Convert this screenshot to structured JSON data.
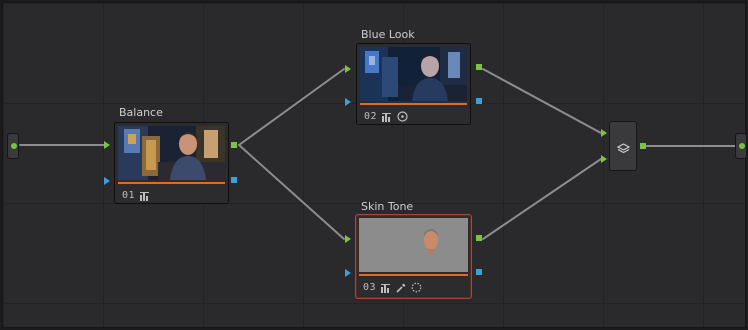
{
  "nodes": [
    {
      "id": "balance",
      "label": "Balance",
      "number": "01",
      "tools": [
        "histogram-icon"
      ]
    },
    {
      "id": "blue-look",
      "label": "Blue Look",
      "number": "02",
      "tools": [
        "histogram-icon",
        "circle-target-icon"
      ]
    },
    {
      "id": "skin-tone",
      "label": "Skin Tone",
      "number": "03",
      "tools": [
        "histogram-icon",
        "eyedropper-icon",
        "dotted-circle-icon"
      ],
      "selected": true
    }
  ],
  "colors": {
    "grid_bg": "#2a2a2c",
    "wire": "#8a8a8a",
    "rgb_port": "#7cc243",
    "alpha_port": "#3aa1da",
    "node_bar": "#e06b26",
    "selected_border": "#a84a33"
  },
  "layer_mixer": {
    "icon": "layers-icon"
  }
}
